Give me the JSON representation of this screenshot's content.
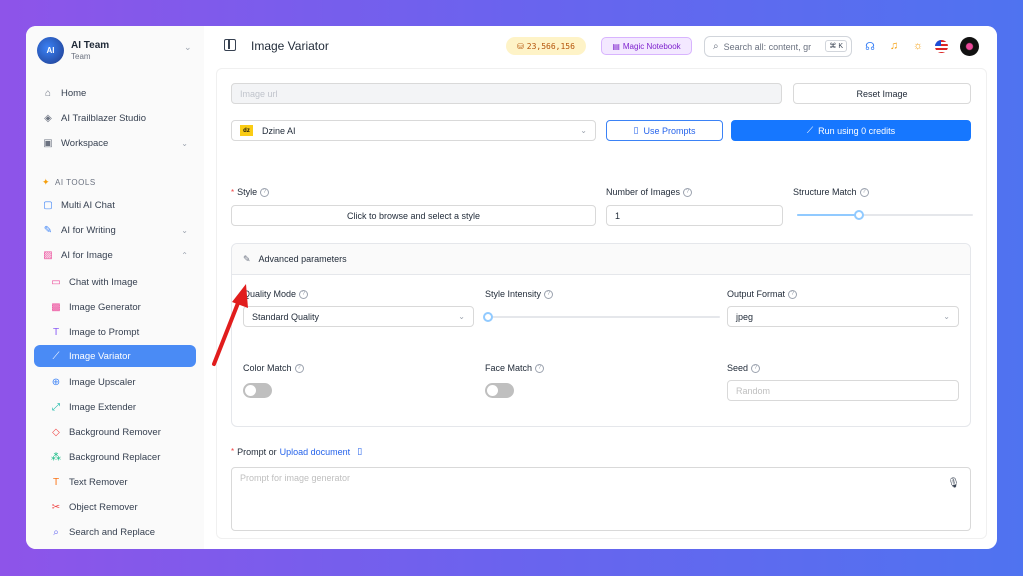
{
  "team": {
    "logo_text": "AI",
    "name": "AI Team",
    "subtitle": "Team"
  },
  "sidebar": {
    "top_items": [
      {
        "label": "Home",
        "icon": "home-icon"
      },
      {
        "label": "AI Trailblazer Studio",
        "icon": "layers-icon"
      },
      {
        "label": "Workspace",
        "icon": "briefcase-icon"
      }
    ],
    "section_label": "AI TOOLS",
    "tool_items": [
      {
        "label": "Multi AI Chat",
        "icon": "chat-icon"
      },
      {
        "label": "AI for Writing",
        "icon": "pen-icon"
      },
      {
        "label": "AI for Image",
        "icon": "image-icon"
      }
    ],
    "image_items": [
      {
        "label": "Chat with Image"
      },
      {
        "label": "Image Generator"
      },
      {
        "label": "Image to Prompt"
      },
      {
        "label": "Image Variator"
      },
      {
        "label": "Image Upscaler"
      },
      {
        "label": "Image Extender"
      },
      {
        "label": "Background Remover"
      },
      {
        "label": "Background Replacer"
      },
      {
        "label": "Text Remover"
      },
      {
        "label": "Object Remover"
      },
      {
        "label": "Search and Replace"
      }
    ],
    "active_item": "Image Variator"
  },
  "header": {
    "title": "Image Variator",
    "credits": "23,566,156",
    "notebook_label": "Magic Notebook",
    "search_placeholder": "Search all: content, gr",
    "search_shortcut": "⌘ K"
  },
  "form": {
    "image_url_placeholder": "Image url",
    "reset_button": "Reset Image",
    "provider": {
      "logo": "dz",
      "value": "Dzine AI"
    },
    "use_prompts_button": "Use Prompts",
    "run_button": "Run using 0 credits",
    "style": {
      "label": "Style",
      "button": "Click to browse and select a style"
    },
    "number_of_images": {
      "label": "Number of Images",
      "value": "1"
    },
    "structure_match": {
      "label": "Structure Match",
      "value_fraction": 0.35
    },
    "advanced": {
      "title": "Advanced parameters",
      "quality_mode": {
        "label": "Quality Mode",
        "value": "Standard Quality"
      },
      "style_intensity": {
        "label": "Style Intensity",
        "value_fraction": 0.0
      },
      "output_format": {
        "label": "Output Format",
        "value": "jpeg"
      },
      "color_match": {
        "label": "Color Match",
        "on": false
      },
      "face_match": {
        "label": "Face Match",
        "on": false
      },
      "seed": {
        "label": "Seed",
        "placeholder": "Random"
      }
    },
    "prompt": {
      "label_prefix": "Prompt or",
      "upload_link": "Upload document",
      "placeholder": "Prompt for image generator"
    }
  },
  "colors": {
    "primary": "#1677ff",
    "sidebar_active": "#4a8bf5",
    "arrow": "#e11d1d"
  }
}
